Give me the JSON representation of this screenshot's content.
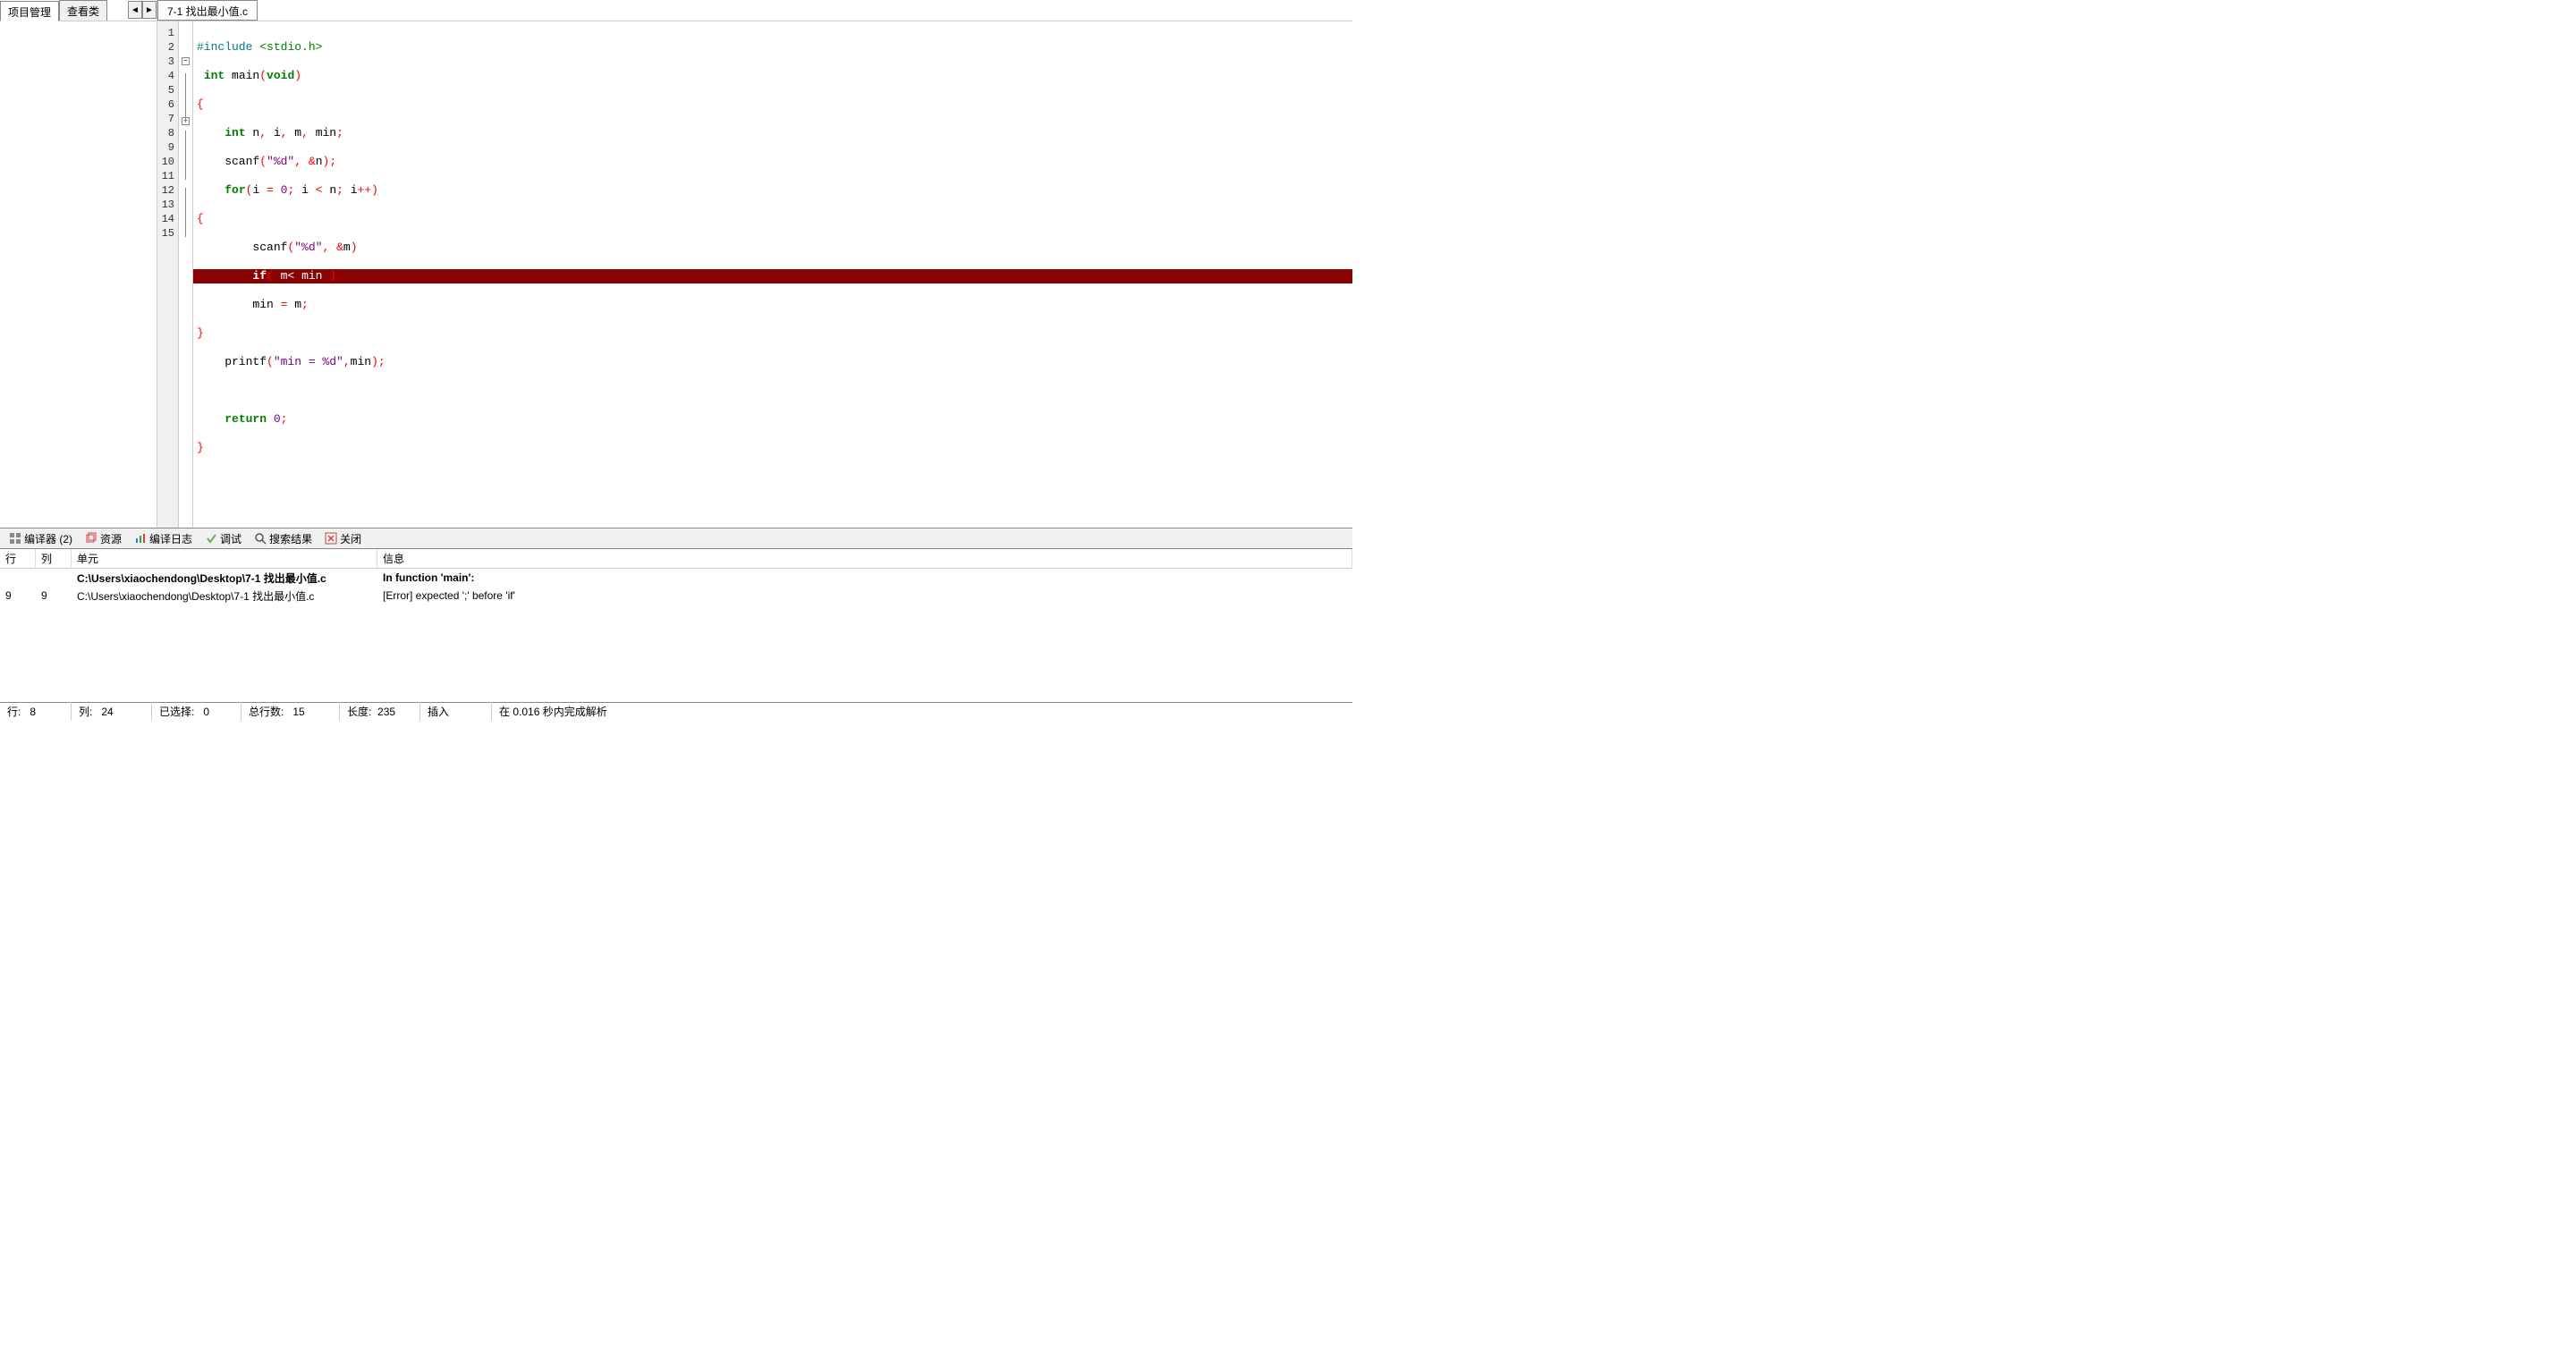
{
  "sidebar": {
    "tabs": [
      "项目管理",
      "查看类"
    ]
  },
  "file_tab": "7-1 找出最小值.c",
  "code": {
    "lines": 15,
    "error_line": 9
  },
  "bottom_tabs": {
    "compiler": "编译器 (2)",
    "resource": "资源",
    "log": "编译日志",
    "debug": "调试",
    "search": "搜索结果",
    "close": "关闭"
  },
  "error_headers": {
    "line": "行",
    "col": "列",
    "unit": "单元",
    "msg": "信息"
  },
  "errors": [
    {
      "line": "",
      "col": "",
      "unit": "C:\\Users\\xiaochendong\\Desktop\\7-1 找出最小值.c",
      "msg": "In function 'main':",
      "bold": true
    },
    {
      "line": "9",
      "col": "9",
      "unit": "C:\\Users\\xiaochendong\\Desktop\\7-1 找出最小值.c",
      "msg": "[Error] expected ';' before 'if'",
      "bold": false
    }
  ],
  "status": {
    "line_label": "行:",
    "line_val": "8",
    "col_label": "列:",
    "col_val": "24",
    "sel_label": "已选择:",
    "sel_val": "0",
    "total_label": "总行数:",
    "total_val": "15",
    "len_label": "长度:",
    "len_val": "235",
    "insert": "插入",
    "parse": "在 0.016 秒内完成解析"
  }
}
